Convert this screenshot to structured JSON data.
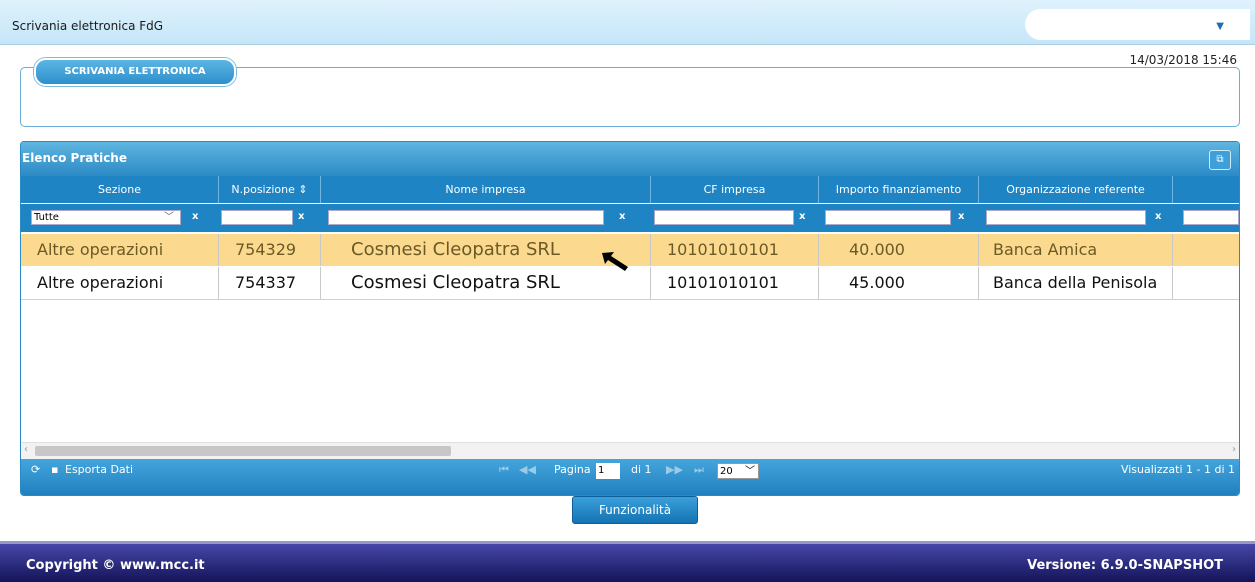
{
  "app": {
    "title": "Scrivania elettronica  FdG",
    "dropdown_icon": "chevron-down-icon"
  },
  "timestamp": "14/03/2018 15:46",
  "desk": {
    "legend": "SCRIVANIA ELETTRONICA"
  },
  "grid": {
    "title": "Elenco Pratiche",
    "columns": [
      "Sezione",
      "N.posizione",
      "Nome impresa",
      "CF impresa",
      "Importo finanziamento",
      "Organizzazione referente"
    ],
    "filters": {
      "sezione_value": "Tutte",
      "clear_label": "x"
    },
    "rows": [
      {
        "sezione": "Altre operazioni",
        "posizione": "754329",
        "nome": "Cosmesi Cleopatra SRL",
        "cf": "10101010101",
        "importo": "40.000",
        "org": "Banca Amica"
      },
      {
        "sezione": "Altre operazioni",
        "posizione": "754337",
        "nome": "Cosmesi Cleopatra SRL",
        "cf": "10101010101",
        "importo": "45.000",
        "org": "Banca della Penisola"
      }
    ],
    "pager": {
      "export": "Esporta Dati",
      "page_label": "Pagina",
      "page_value": "1",
      "of_label": "di 1",
      "page_size": "20",
      "visible": "Visualizzati 1 - 1 di 1"
    }
  },
  "actions": {
    "funzionalita": "Funzionalità"
  },
  "footer": {
    "copyright": "Copyright © www.mcc.it",
    "version": "Versione: 6.9.0-SNAPSHOT"
  },
  "colors": {
    "selected_row": "#fbd98e",
    "header_blue": "#1f84c4",
    "footer": "#1e1e6e"
  }
}
